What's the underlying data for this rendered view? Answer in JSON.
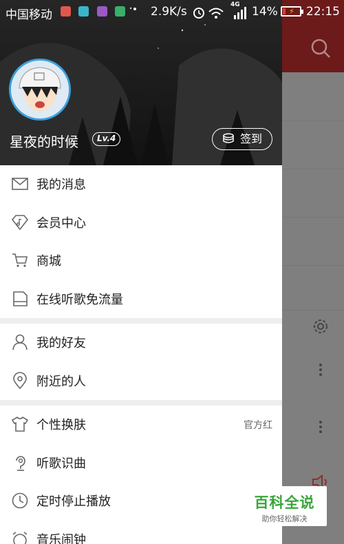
{
  "status_bar": {
    "carrier": "中国移动",
    "speed": "2.9K/s",
    "network": "4G",
    "battery": "14%",
    "time": "22:15"
  },
  "profile": {
    "username": "星夜的时候",
    "level": "Lv.4",
    "checkin_label": "签到"
  },
  "menu_group_1": [
    {
      "label": "我的消息",
      "icon": "mail-icon"
    },
    {
      "label": "会员中心",
      "icon": "diamond-music-icon"
    },
    {
      "label": "商城",
      "icon": "cart-icon"
    },
    {
      "label": "在线听歌免流量",
      "icon": "sim-card-icon"
    }
  ],
  "menu_group_2": [
    {
      "label": "我的好友",
      "icon": "person-icon"
    },
    {
      "label": "附近的人",
      "icon": "location-pin-icon"
    }
  ],
  "menu_group_3": [
    {
      "label": "个性换肤",
      "icon": "tshirt-icon",
      "value": "官方红"
    },
    {
      "label": "听歌识曲",
      "icon": "mic-icon"
    },
    {
      "label": "定时停止播放",
      "icon": "clock-icon"
    },
    {
      "label": "音乐闹钟",
      "icon": "alarm-icon"
    }
  ],
  "watermark": {
    "title": "百科全说",
    "subtitle": "助你轻松解决"
  },
  "colors": {
    "accent_red": "#c62f2f",
    "drawer_bg": "#ffffff",
    "header_bg": "#1e1e1e",
    "watermark_green": "#39a53b"
  }
}
